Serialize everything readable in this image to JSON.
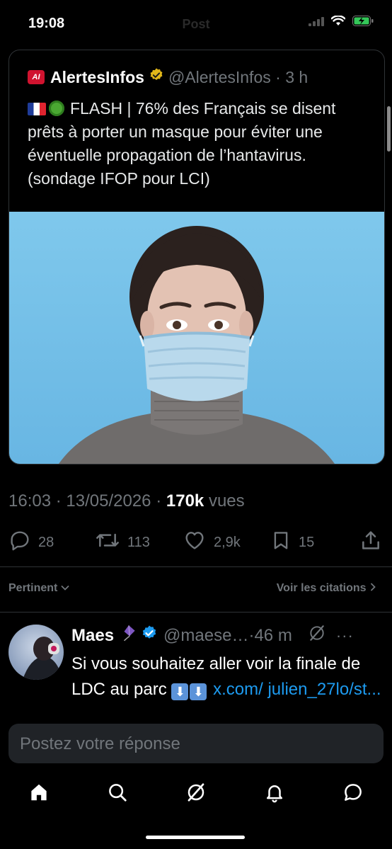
{
  "status": {
    "time": "19:08"
  },
  "nav": {
    "title": "Post"
  },
  "quoted": {
    "name": "AlertesInfos",
    "handle": "@AlertesInfos",
    "age": "3 h",
    "text": "FLASH | 76% des Français se disent prêts à porter un masque pour éviter une éventuelle propagation de l’hantavirus. (sondage IFOP pour LCI)",
    "logo_text": "AI"
  },
  "meta": {
    "time": "16:03",
    "date": "13/05/2026",
    "views": "170k",
    "views_label": "vues"
  },
  "actions": {
    "replies": "28",
    "reposts": "113",
    "likes": "2,9k",
    "bookmarks": "15"
  },
  "replies_bar": {
    "sort": "Pertinent",
    "quotes": "Voir les citations"
  },
  "reply": {
    "name": "Maes",
    "handle": "@maese…",
    "age": "46 m",
    "text_start": "Si vous souhaitez aller voir la finale de LDC au parc",
    "link": "x.com/",
    "link_cut": "julien_27lo/st..."
  },
  "composer": {
    "placeholder": "Postez votre réponse"
  },
  "colors": {
    "accent": "#1d9bf0",
    "verified": "#1d9bf0",
    "gold": "#e2b719",
    "muted": "#71767b"
  },
  "icons": [
    "home-icon",
    "search-icon",
    "grok-icon",
    "notifications-icon",
    "messages-icon"
  ]
}
